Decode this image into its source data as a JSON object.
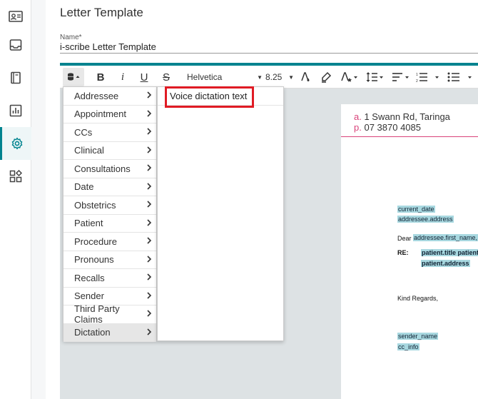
{
  "sidebar": {
    "items": [
      {
        "icon": "contact-card-icon",
        "active": false
      },
      {
        "icon": "inbox-icon",
        "active": false
      },
      {
        "icon": "book-icon",
        "active": false
      },
      {
        "icon": "chart-icon",
        "active": false
      },
      {
        "icon": "gear-icon",
        "active": true
      },
      {
        "icon": "widgets-icon",
        "active": false
      }
    ]
  },
  "page": {
    "title": "Letter Template",
    "name_label": "Name*",
    "name_value": "i-scribe Letter Template"
  },
  "toolbar": {
    "bold": "B",
    "italic": "i",
    "underline": "U",
    "strike": "S",
    "font": "Helvetica",
    "size": "8.25"
  },
  "menu": {
    "items": [
      "Addressee",
      "Appointment",
      "CCs",
      "Clinical",
      "Consultations",
      "Date",
      "Obstetrics",
      "Patient",
      "Procedure",
      "Pronouns",
      "Recalls",
      "Sender",
      "Third Party Claims",
      "Dictation"
    ],
    "active": "Dictation",
    "submenu": [
      "Voice dictation text"
    ]
  },
  "letter": {
    "addr_label_a": "a.",
    "addr_a": "1 Swann Rd, Taringa",
    "addr_label_p": "p.",
    "addr_p": "07 3870 4085",
    "current_date": "current_date",
    "addressee_address": "addressee.address",
    "dear": "Dear",
    "first_name": "addressee.first_name,",
    "re": "RE:",
    "patient_title": "patient.title patient",
    "patient_address": "patient.address",
    "kind_regards": "Kind Regards,",
    "sender_name": "sender_name",
    "cc_info": "cc_info"
  },
  "colors": {
    "accent": "#00838f",
    "highlight": "#e01b24",
    "brand_pink": "#d9437a"
  }
}
